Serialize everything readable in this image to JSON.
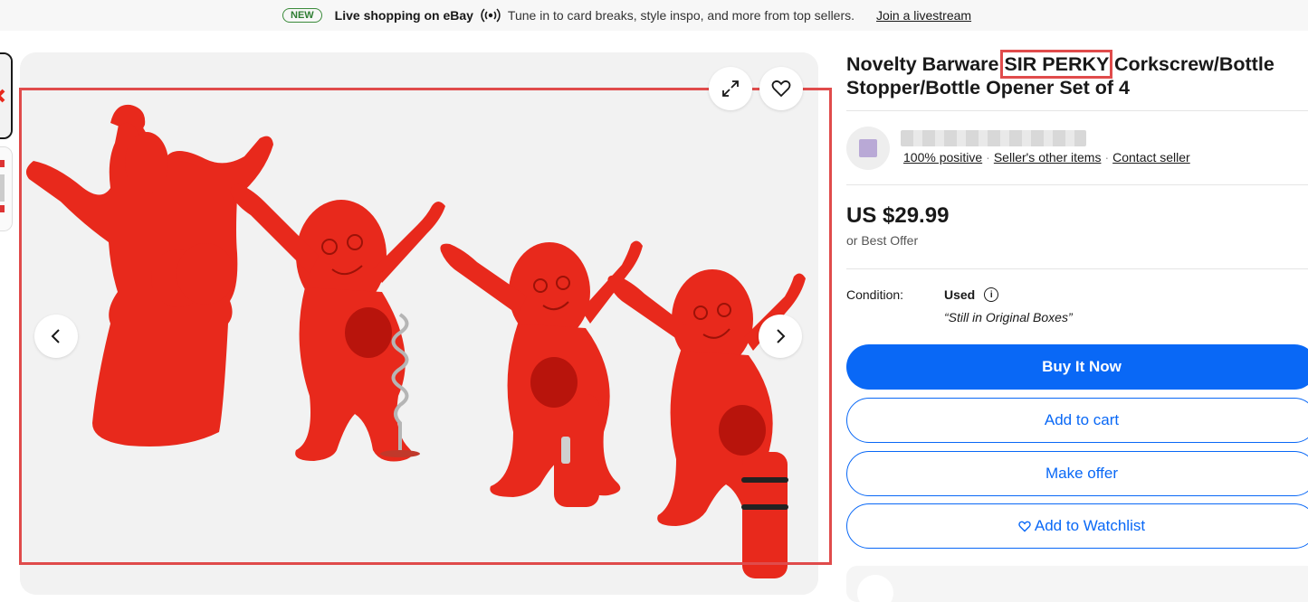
{
  "banner": {
    "badge": "NEW",
    "title": "Live shopping on eBay",
    "description": "Tune in to card breaks, style inspo, and more from top sellers.",
    "link": "Join a livestream"
  },
  "listing": {
    "title_before": "Novelty Barware ",
    "title_highlight": "SIR PERKY",
    "title_after": " Corkscrew/Bottle Stopper/Bottle Opener Set of 4"
  },
  "seller": {
    "feedback": "100% positive",
    "other_items": "Seller's other items",
    "contact": "Contact seller"
  },
  "price": {
    "amount": "US $29.99",
    "best_offer": "or Best Offer"
  },
  "condition": {
    "label": "Condition:",
    "value": "Used",
    "note": "“Still in Original Boxes”"
  },
  "actions": {
    "buy_now": "Buy It Now",
    "add_to_cart": "Add to cart",
    "make_offer": "Make offer",
    "watchlist": "Add to Watchlist"
  },
  "colors": {
    "accent_blue": "#0968f6",
    "product_red": "#e8291c",
    "highlight_red": "#e04b4b",
    "badge_green": "#2e7d32"
  }
}
